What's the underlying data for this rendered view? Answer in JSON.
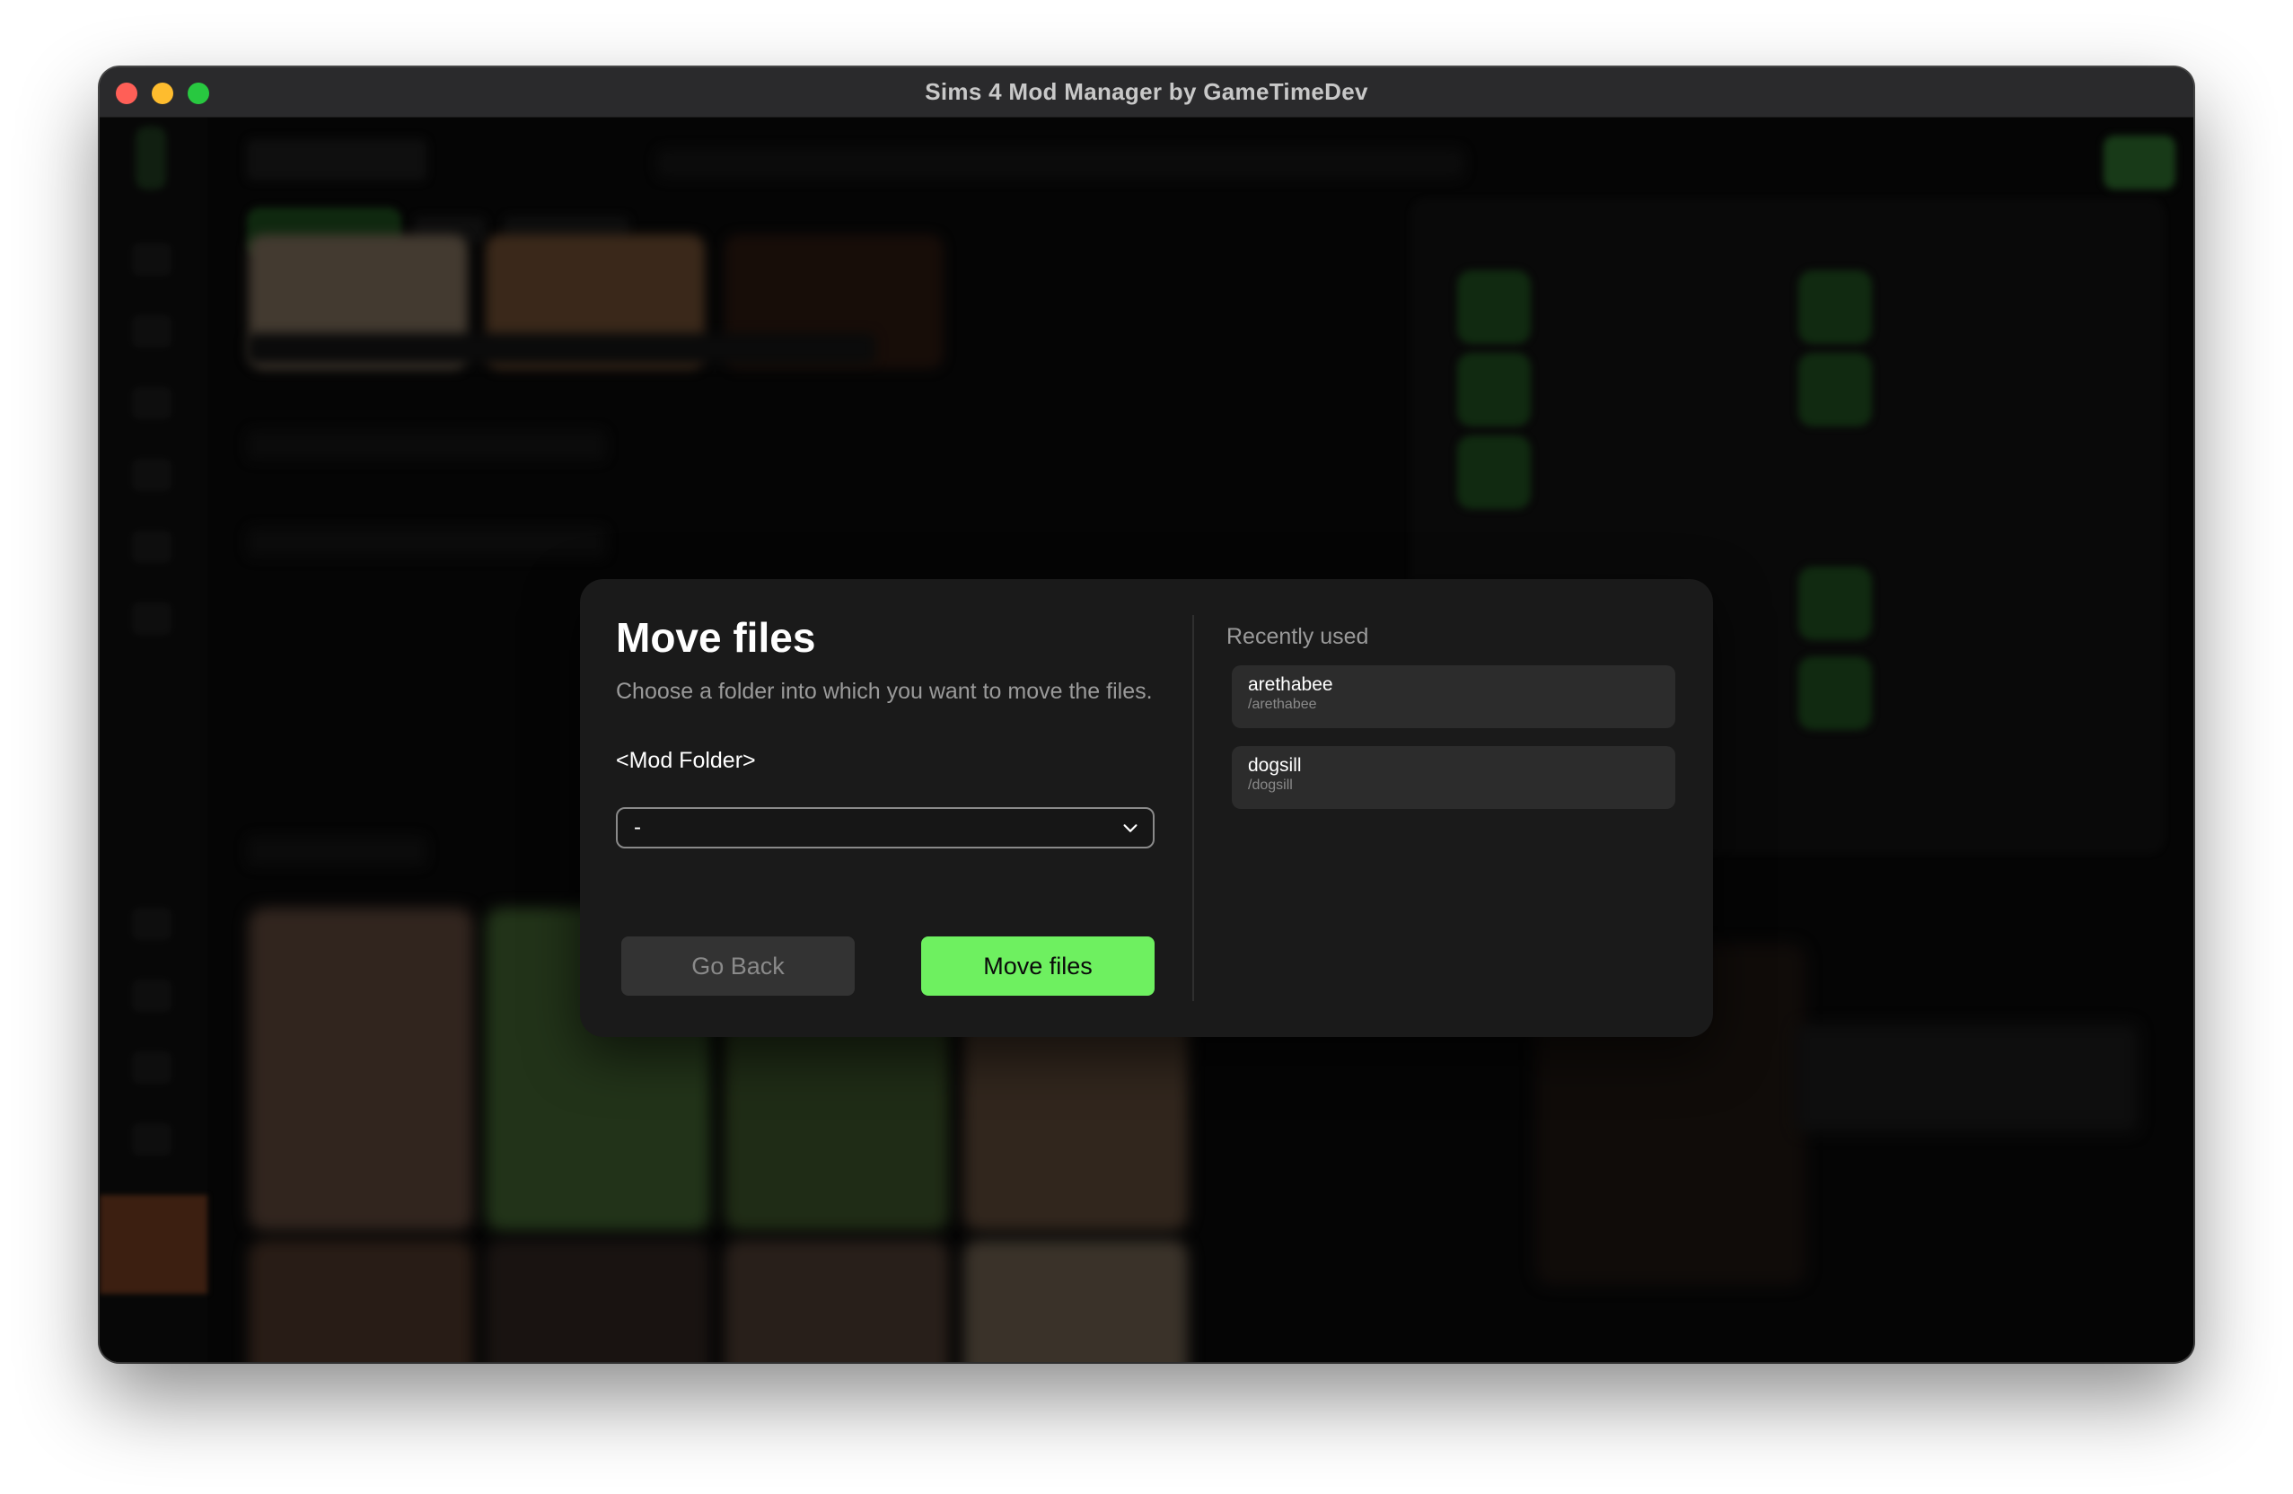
{
  "window": {
    "title": "Sims 4 Mod Manager by GameTimeDev"
  },
  "dialog": {
    "title": "Move files",
    "description": "Choose a folder into which you want to move the files.",
    "folder_label": "<Mod Folder>",
    "folder_select": {
      "selected": "-"
    },
    "buttons": {
      "back_label": "Go Back",
      "move_label": "Move files"
    },
    "recent": {
      "heading": "Recently used",
      "items": [
        {
          "name": "arethabee",
          "path": "/arethabee"
        },
        {
          "name": "dogsill",
          "path": "/dogsill"
        }
      ]
    }
  },
  "colors": {
    "accent": "#6ef060",
    "dialog_bg": "#1a1a1a",
    "item_bg": "#2c2c2c"
  }
}
